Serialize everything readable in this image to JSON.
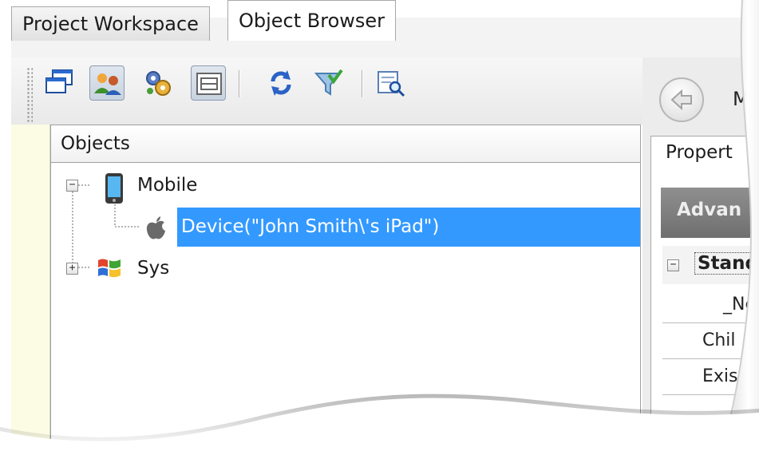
{
  "tabs": [
    {
      "label": "Project Workspace",
      "active": false
    },
    {
      "label": "Object Browser",
      "active": true
    }
  ],
  "toolbar": {
    "buttons": [
      {
        "icon": "windows-cascade-icon",
        "pressed": false
      },
      {
        "icon": "users-objects-icon",
        "pressed": true
      },
      {
        "icon": "gears-icon",
        "pressed": false
      },
      {
        "icon": "frame-view-icon",
        "pressed": true
      },
      {
        "icon": "refresh-icon",
        "pressed": false
      },
      {
        "icon": "filter-icon",
        "pressed": false
      },
      {
        "icon": "find-object-icon",
        "pressed": false
      }
    ]
  },
  "tree": {
    "header": "Objects",
    "nodes": [
      {
        "label": "Mobile",
        "icon": "mobile-device-icon",
        "expanded": true
      },
      {
        "label": "Device(\"John Smith\\'s iPad\")",
        "icon": "apple-icon",
        "selected": true
      },
      {
        "label": "Sys",
        "icon": "windows-logo-icon",
        "expanded": false
      }
    ]
  },
  "right": {
    "nav_caption": "M",
    "properties_tab": "Propert",
    "toolbar_caption": "Advan",
    "group_label": "Stand",
    "rows": [
      "_Ne",
      "Chil",
      "Exis"
    ]
  },
  "colors": {
    "selection": "#3399ff",
    "objects_strip": "#fcfce4",
    "props_toolbar": "#7f7f7f"
  }
}
